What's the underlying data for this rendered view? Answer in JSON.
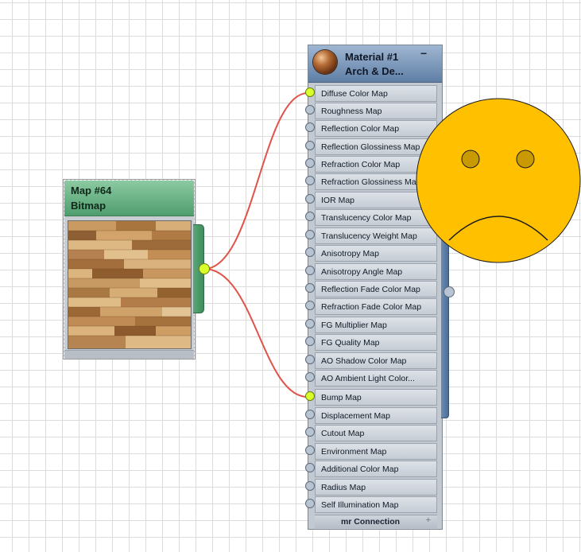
{
  "bitmap_node": {
    "title": "Map #64",
    "subtitle": "Bitmap"
  },
  "material_node": {
    "title": "Material #1",
    "subtitle": "Arch & De...",
    "collapse_label": "−",
    "slots": [
      {
        "label": "Diffuse Color Map",
        "connected": true
      },
      {
        "label": "Roughness Map",
        "connected": false
      },
      {
        "label": "Reflection Color Map",
        "connected": false
      },
      {
        "label": "Reflection Glossiness Map",
        "connected": false
      },
      {
        "label": "Refraction Color Map",
        "connected": false
      },
      {
        "label": "Refraction Glossiness Map",
        "connected": false
      },
      {
        "label": "IOR Map",
        "connected": false
      },
      {
        "label": "Translucency Color Map",
        "connected": false
      },
      {
        "label": "Translucency Weight Map",
        "connected": false
      },
      {
        "label": "Anisotropy Map",
        "connected": false
      },
      {
        "label": "Anisotropy Angle Map",
        "connected": false
      },
      {
        "label": "Reflection Fade Color Map",
        "connected": false
      },
      {
        "label": "Refraction Fade Color Map",
        "connected": false
      },
      {
        "label": "FG Multiplier Map",
        "connected": false
      },
      {
        "label": "FG Quality Map",
        "connected": false
      },
      {
        "label": "AO Shadow Color Map",
        "connected": false
      },
      {
        "label": "AO Ambient Light Color...",
        "connected": false
      },
      {
        "label": "Bump Map",
        "connected": true
      },
      {
        "label": "Displacement Map",
        "connected": false
      },
      {
        "label": "Cutout Map",
        "connected": false
      },
      {
        "label": "Environment Map",
        "connected": false
      },
      {
        "label": "Additional Color Map",
        "connected": false
      },
      {
        "label": "Radius Map",
        "connected": false
      },
      {
        "label": "Self Illumination Map",
        "connected": false
      }
    ],
    "footer_label": "mr Connection",
    "footer_icon": "plus-icon"
  },
  "colors": {
    "wire": "#e0524a",
    "active_socket": "#d8ff2a",
    "bitmap_header": "#5fae7e",
    "material_header": "#7b98bd",
    "face": "#ffc000"
  },
  "overlay": {
    "icon": "sad-face-icon"
  }
}
